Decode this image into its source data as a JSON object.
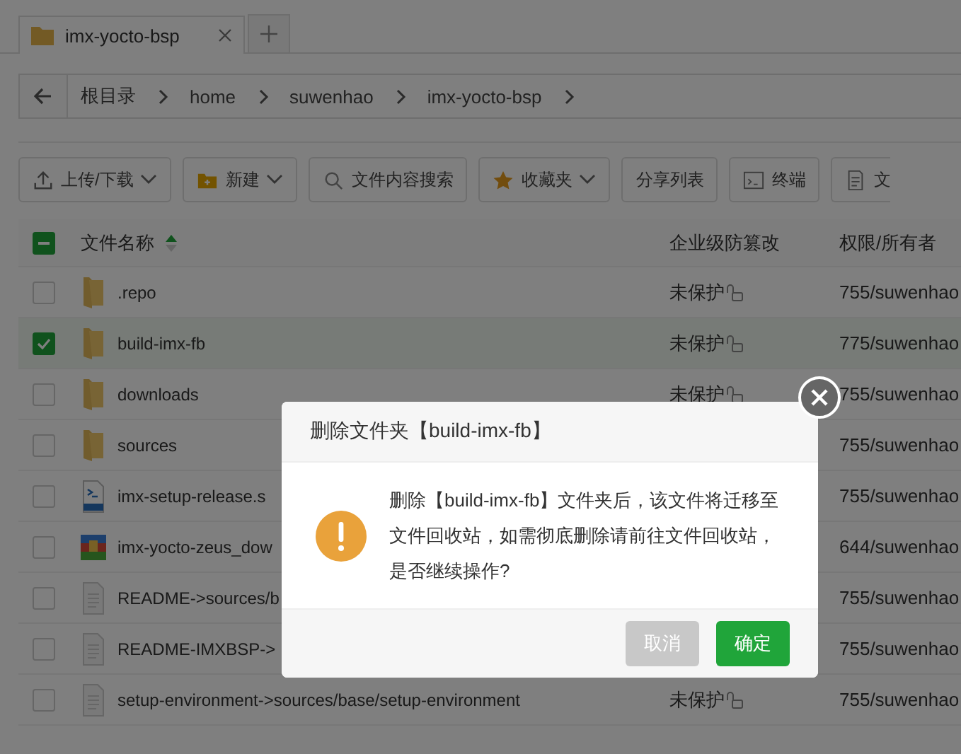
{
  "tabs": [
    {
      "label": "imx-yocto-bsp",
      "selected": true
    }
  ],
  "breadcrumb": [
    "根目录",
    "home",
    "suwenhao",
    "imx-yocto-bsp"
  ],
  "toolbar": [
    {
      "label": "上传/下载",
      "kind": "upload",
      "dropdown": true
    },
    {
      "label": "新建",
      "kind": "folder",
      "dropdown": true
    },
    {
      "label": "文件内容搜索",
      "kind": "search",
      "dropdown": false
    },
    {
      "label": "收藏夹",
      "kind": "star",
      "dropdown": true
    },
    {
      "label": "分享列表",
      "kind": "plain",
      "dropdown": false
    },
    {
      "label": "终端",
      "kind": "terminal",
      "dropdown": false
    },
    {
      "label": "文",
      "kind": "doc",
      "dropdown": false
    }
  ],
  "table": {
    "select_all_checked": true,
    "select_all_partial": true,
    "columns": [
      "文件名称",
      "企业级防篡改",
      "权限/所有者"
    ],
    "rows": [
      {
        "name": ".repo",
        "kind": "folder",
        "checked": false,
        "protection": "未保护",
        "permission": "755/suwenhao"
      },
      {
        "name": "build-imx-fb",
        "kind": "folder",
        "checked": true,
        "protection": "未保护",
        "permission": "775/suwenhao"
      },
      {
        "name": "downloads",
        "kind": "folder",
        "checked": false,
        "protection": "未保护",
        "permission": "755/suwenhao"
      },
      {
        "name": "sources",
        "kind": "folder",
        "checked": false,
        "permission": "755/suwenhao"
      },
      {
        "name": "imx-setup-release.s",
        "kind": "shell",
        "checked": false,
        "permission": "755/suwenhao"
      },
      {
        "name": "imx-yocto-zeus_dow",
        "kind": "archive",
        "checked": false,
        "permission": "644/suwenhao"
      },
      {
        "name": "README->sources/b",
        "kind": "file",
        "checked": false,
        "permission": "755/suwenhao"
      },
      {
        "name": "README-IMXBSP->",
        "kind": "file",
        "checked": false,
        "permission": "755/suwenhao"
      },
      {
        "name": "setup-environment->sources/base/setup-environment",
        "kind": "file",
        "checked": false,
        "protection": "未保护",
        "permission": "755/suwenhao"
      }
    ]
  },
  "dialog": {
    "title": "删除文件夹【build-imx-fb】",
    "message": "删除【build-imx-fb】文件夹后，该文件将迁移至文件回收站，如需彻底删除请前往文件回收站，是否继续操作?",
    "buttons": [
      {
        "label": "取消",
        "kind": "cancel"
      },
      {
        "label": "确定",
        "kind": "confirm"
      }
    ]
  }
}
